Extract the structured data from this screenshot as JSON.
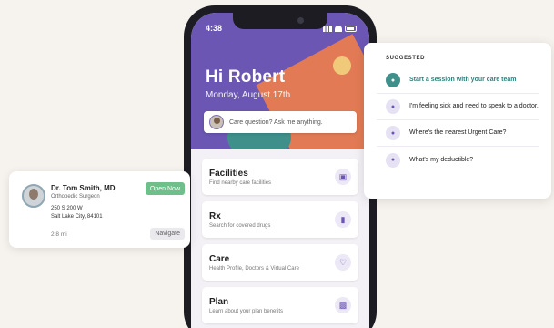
{
  "colors": {
    "brand_purple": "#6b57b3",
    "accent_orange": "#e27b55",
    "accent_teal": "#3f8f8a",
    "open_green": "#6fbf8a"
  },
  "status_bar": {
    "time": "4:38"
  },
  "home": {
    "greeting": "Hi Robert",
    "date": "Monday, August 17th",
    "ask_placeholder": "Care question? Ask me anything."
  },
  "menu_cards": [
    {
      "title": "Facilities",
      "subtitle": "Find nearby care facilities",
      "icon": "building-icon"
    },
    {
      "title": "Rx",
      "subtitle": "Search for covered drugs",
      "icon": "pill-icon"
    },
    {
      "title": "Care",
      "subtitle": "Health Profile, Doctors & Virtual Care",
      "icon": "heart-icon"
    },
    {
      "title": "Plan",
      "subtitle": "Learn about your plan benefits",
      "icon": "briefcase-icon"
    }
  ],
  "doctor": {
    "name": "Dr. Tom Smith, MD",
    "specialty": "Orthopedic Surgeon",
    "address_line1": "250 S 200 W",
    "address_line2": "Salt Lake City, 84101",
    "distance": "2.8 mi",
    "status": "Open Now",
    "navigate_label": "Navigate"
  },
  "suggested": {
    "heading": "SUGGESTED",
    "items": [
      {
        "text": "Start a session with your care team",
        "icon": "chat-icon"
      },
      {
        "text": "I'm feeling sick and need to speak to a doctor.",
        "icon": "chat-icon"
      },
      {
        "text": "Where's the nearest Urgent Care?",
        "icon": "chat-icon"
      },
      {
        "text": "What's my deductible?",
        "icon": "chat-icon"
      }
    ]
  }
}
